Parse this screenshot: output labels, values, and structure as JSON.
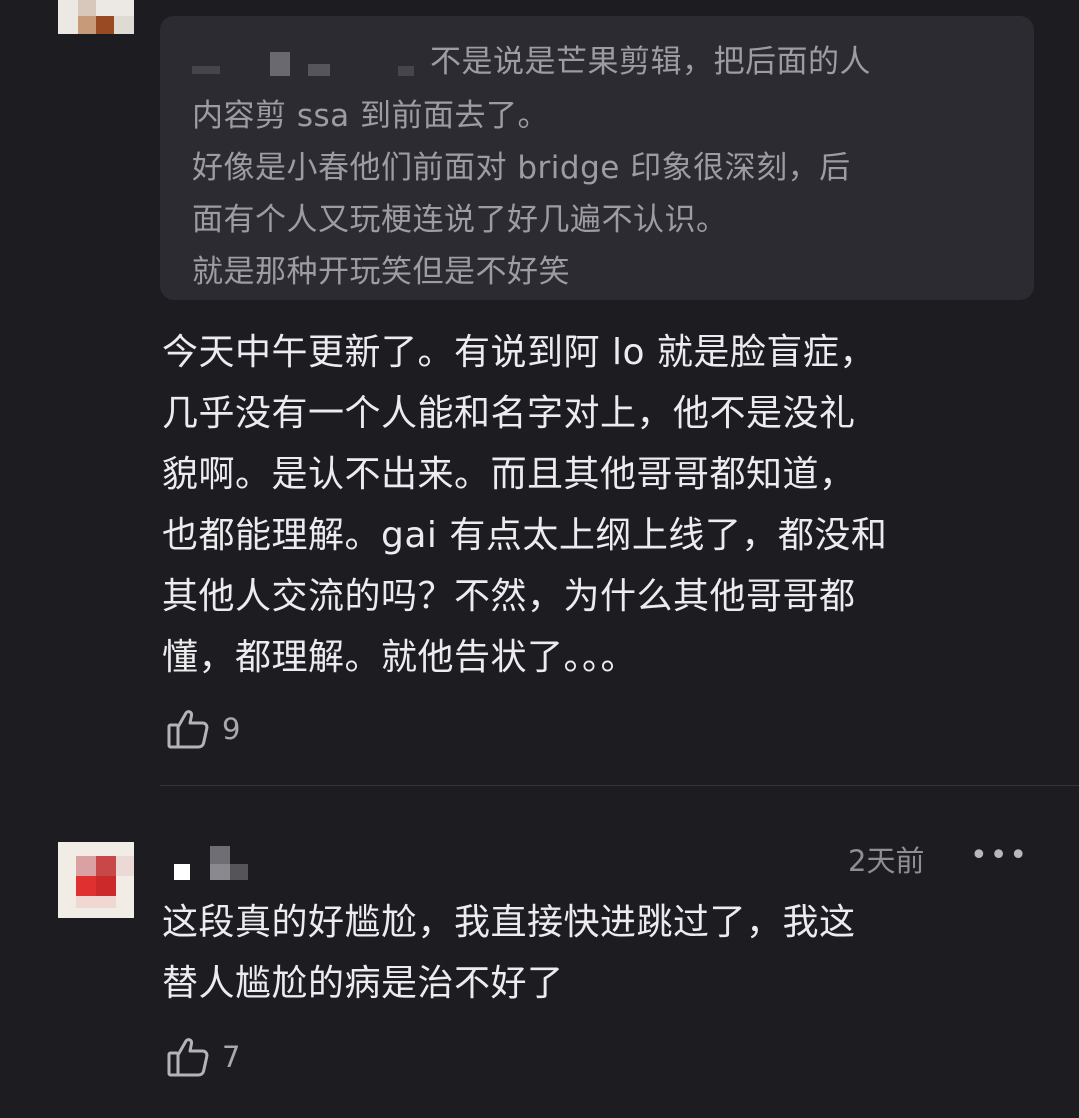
{
  "quoted_reply": {
    "lines": [
      "不是说是芒果剪辑，把后面的人",
      "内容剪 ssa 到前面去了。",
      "好像是小春他们前面对 bridge 印象很深刻，后",
      "面有个人又玩梗连说了好几遍不认识。",
      "就是那种开玩笑但是不好笑"
    ]
  },
  "comment1": {
    "lines": [
      "今天中午更新了。有说到阿 lo 就是脸盲症，",
      "几乎没有一个人能和名字对上，他不是没礼",
      "貌啊。是认不出来。而且其他哥哥都知道，",
      "也都能理解。gai 有点太上纲上线了，都没和",
      "其他人交流的吗？不然，为什么其他哥哥都",
      "懂，都理解。就他告状了。。。"
    ],
    "like_icon": "thumbs-up-icon",
    "like_count": "9"
  },
  "comment2": {
    "timestamp": "2天前",
    "more_label": "•••",
    "lines": [
      "这段真的好尴尬，我直接快进跳过了，我这",
      "替人尴尬的病是治不好了"
    ],
    "like_icon": "thumbs-up-icon",
    "like_count": "7"
  },
  "colors": {
    "background": "#1d1c21",
    "quote_background": "#2c2b31",
    "quote_text": "#9d9ca3",
    "body_text": "#ececef",
    "meta_text": "#8f8e95"
  }
}
